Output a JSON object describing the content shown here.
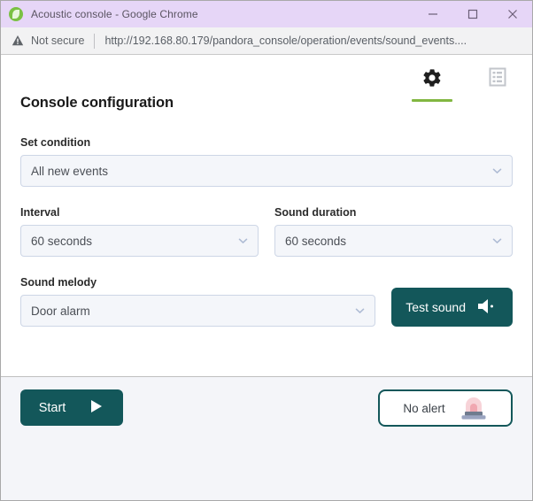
{
  "window": {
    "title": "Acoustic console - Google Chrome",
    "favicon_name": "pandora-logo-icon",
    "minimize_label": "Minimize",
    "maximize_label": "Maximize",
    "close_label": "Close"
  },
  "addressbar": {
    "security_icon": "warning-triangle-icon",
    "security_label": "Not secure",
    "url": "http://192.168.80.179/pandora_console/operation/events/sound_events...."
  },
  "tabs": [
    {
      "name": "configuration",
      "icon": "gear-icon",
      "active": true
    },
    {
      "name": "event-list",
      "icon": "list-icon",
      "active": false
    }
  ],
  "form": {
    "section_title": "Console configuration",
    "fields": [
      {
        "label": "Set condition",
        "value": "All new events"
      },
      {
        "label": "Interval",
        "value": "60 seconds"
      },
      {
        "label": "Sound duration",
        "value": "60 seconds"
      },
      {
        "label": "Sound melody",
        "value": "Door alarm"
      }
    ],
    "test_sound_button": {
      "label": "Test sound",
      "icon": "speaker-icon"
    }
  },
  "footer": {
    "start_button": {
      "label": "Start",
      "icon": "play-icon"
    },
    "alert_status": {
      "label": "No alert",
      "icon": "siren-light-icon"
    }
  },
  "colors": {
    "titlebar": "#e6d6f7",
    "accent_teal": "#13575a",
    "tab_active_underline": "#82b741",
    "select_bg": "#f4f6fa",
    "select_border": "#cdd6e6",
    "page_bg": "#f4f5f9",
    "siren_pink": "#f3c9cf",
    "siren_base": "#9aa4c0"
  }
}
